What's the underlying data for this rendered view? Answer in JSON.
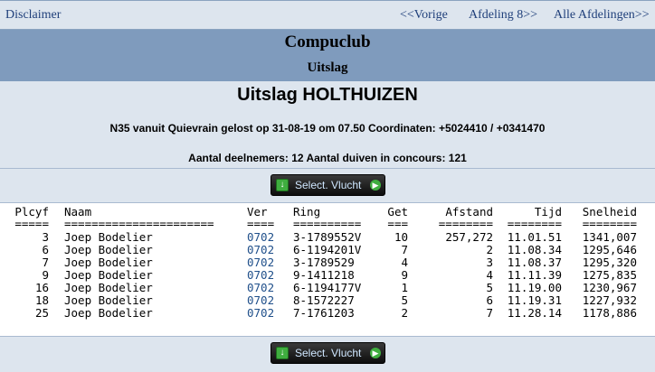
{
  "nav": {
    "disclaimer": "Disclaimer",
    "prev": "<<Vorige",
    "next": "Afdeling 8>>",
    "all": "Alle Afdelingen>>"
  },
  "banner": {
    "club": "Compuclub",
    "sub": "Uitslag"
  },
  "header": {
    "title": "Uitslag HOLTHUIZEN",
    "flight": "N35 vanuit Quievrain gelost op 31-08-19 om 07.50 Coordinaten: +5024410 / +0341470",
    "counts": "Aantal deelnemers: 12 Aantal duiven in concours: 121"
  },
  "button": {
    "label": "Select. Vlucht"
  },
  "table": {
    "headers": [
      "Plcyf",
      "Naam",
      "Ver",
      "Ring",
      "Get",
      "Afstand",
      "Tijd",
      "Snelheid"
    ],
    "separators": [
      "=====",
      "======================",
      "====",
      "==========",
      "===",
      "========",
      "========",
      "========"
    ],
    "rows": [
      [
        "3",
        "Joep Bodelier",
        "0702",
        "3-1789552V",
        "10",
        "257,272",
        "11.01.51",
        "1341,007"
      ],
      [
        "6",
        "Joep Bodelier",
        "0702",
        "6-1194201V",
        "7",
        "2",
        "11.08.34",
        "1295,646"
      ],
      [
        "7",
        "Joep Bodelier",
        "0702",
        "3-1789529",
        "4",
        "3",
        "11.08.37",
        "1295,320"
      ],
      [
        "9",
        "Joep Bodelier",
        "0702",
        "9-1411218",
        "9",
        "4",
        "11.11.39",
        "1275,835"
      ],
      [
        "16",
        "Joep Bodelier",
        "0702",
        "6-1194177V",
        "1",
        "5",
        "11.19.00",
        "1230,967"
      ],
      [
        "18",
        "Joep Bodelier",
        "0702",
        "8-1572227",
        "5",
        "6",
        "11.19.31",
        "1227,932"
      ],
      [
        "25",
        "Joep Bodelier",
        "0702",
        "7-1761203",
        "2",
        "7",
        "11.28.14",
        "1178,886"
      ]
    ]
  }
}
